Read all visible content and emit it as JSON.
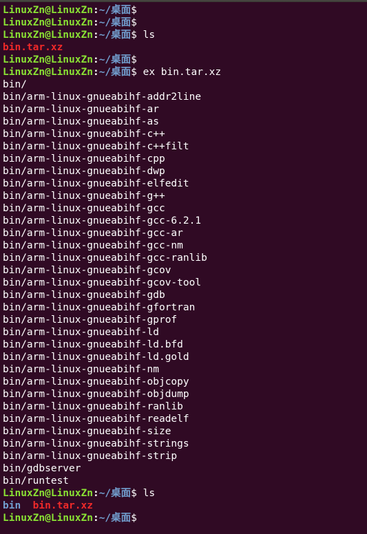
{
  "theme": {
    "background": "#300a24",
    "prompt_user_color": "#8ae234",
    "prompt_path_color": "#729fcf",
    "archive_color": "#ef2929",
    "directory_color": "#729fcf"
  },
  "prompt": {
    "user_host": "LinuxZn@LinuxZn",
    "colon": ":",
    "path": "~/桌面",
    "symbol": "$"
  },
  "lines": [
    {
      "type": "prompt",
      "command": ""
    },
    {
      "type": "prompt",
      "command": ""
    },
    {
      "type": "prompt",
      "command": " ls"
    },
    {
      "type": "files",
      "items": [
        {
          "name": "bin.tar.xz",
          "kind": "archive"
        }
      ]
    },
    {
      "type": "prompt",
      "command": ""
    },
    {
      "type": "prompt",
      "command": " ex bin.tar.xz"
    },
    {
      "type": "output",
      "text": "bin/"
    },
    {
      "type": "output",
      "text": "bin/arm-linux-gnueabihf-addr2line"
    },
    {
      "type": "output",
      "text": "bin/arm-linux-gnueabihf-ar"
    },
    {
      "type": "output",
      "text": "bin/arm-linux-gnueabihf-as"
    },
    {
      "type": "output",
      "text": "bin/arm-linux-gnueabihf-c++"
    },
    {
      "type": "output",
      "text": "bin/arm-linux-gnueabihf-c++filt"
    },
    {
      "type": "output",
      "text": "bin/arm-linux-gnueabihf-cpp"
    },
    {
      "type": "output",
      "text": "bin/arm-linux-gnueabihf-dwp"
    },
    {
      "type": "output",
      "text": "bin/arm-linux-gnueabihf-elfedit"
    },
    {
      "type": "output",
      "text": "bin/arm-linux-gnueabihf-g++"
    },
    {
      "type": "output",
      "text": "bin/arm-linux-gnueabihf-gcc"
    },
    {
      "type": "output",
      "text": "bin/arm-linux-gnueabihf-gcc-6.2.1"
    },
    {
      "type": "output",
      "text": "bin/arm-linux-gnueabihf-gcc-ar"
    },
    {
      "type": "output",
      "text": "bin/arm-linux-gnueabihf-gcc-nm"
    },
    {
      "type": "output",
      "text": "bin/arm-linux-gnueabihf-gcc-ranlib"
    },
    {
      "type": "output",
      "text": "bin/arm-linux-gnueabihf-gcov"
    },
    {
      "type": "output",
      "text": "bin/arm-linux-gnueabihf-gcov-tool"
    },
    {
      "type": "output",
      "text": "bin/arm-linux-gnueabihf-gdb"
    },
    {
      "type": "output",
      "text": "bin/arm-linux-gnueabihf-gfortran"
    },
    {
      "type": "output",
      "text": "bin/arm-linux-gnueabihf-gprof"
    },
    {
      "type": "output",
      "text": "bin/arm-linux-gnueabihf-ld"
    },
    {
      "type": "output",
      "text": "bin/arm-linux-gnueabihf-ld.bfd"
    },
    {
      "type": "output",
      "text": "bin/arm-linux-gnueabihf-ld.gold"
    },
    {
      "type": "output",
      "text": "bin/arm-linux-gnueabihf-nm"
    },
    {
      "type": "output",
      "text": "bin/arm-linux-gnueabihf-objcopy"
    },
    {
      "type": "output",
      "text": "bin/arm-linux-gnueabihf-objdump"
    },
    {
      "type": "output",
      "text": "bin/arm-linux-gnueabihf-ranlib"
    },
    {
      "type": "output",
      "text": "bin/arm-linux-gnueabihf-readelf"
    },
    {
      "type": "output",
      "text": "bin/arm-linux-gnueabihf-size"
    },
    {
      "type": "output",
      "text": "bin/arm-linux-gnueabihf-strings"
    },
    {
      "type": "output",
      "text": "bin/arm-linux-gnueabihf-strip"
    },
    {
      "type": "output",
      "text": "bin/gdbserver"
    },
    {
      "type": "output",
      "text": "bin/runtest"
    },
    {
      "type": "prompt",
      "command": " ls"
    },
    {
      "type": "files",
      "items": [
        {
          "name": "bin",
          "kind": "dir"
        },
        {
          "name": "bin.tar.xz",
          "kind": "archive"
        }
      ]
    },
    {
      "type": "prompt",
      "command": "",
      "active": true
    }
  ]
}
